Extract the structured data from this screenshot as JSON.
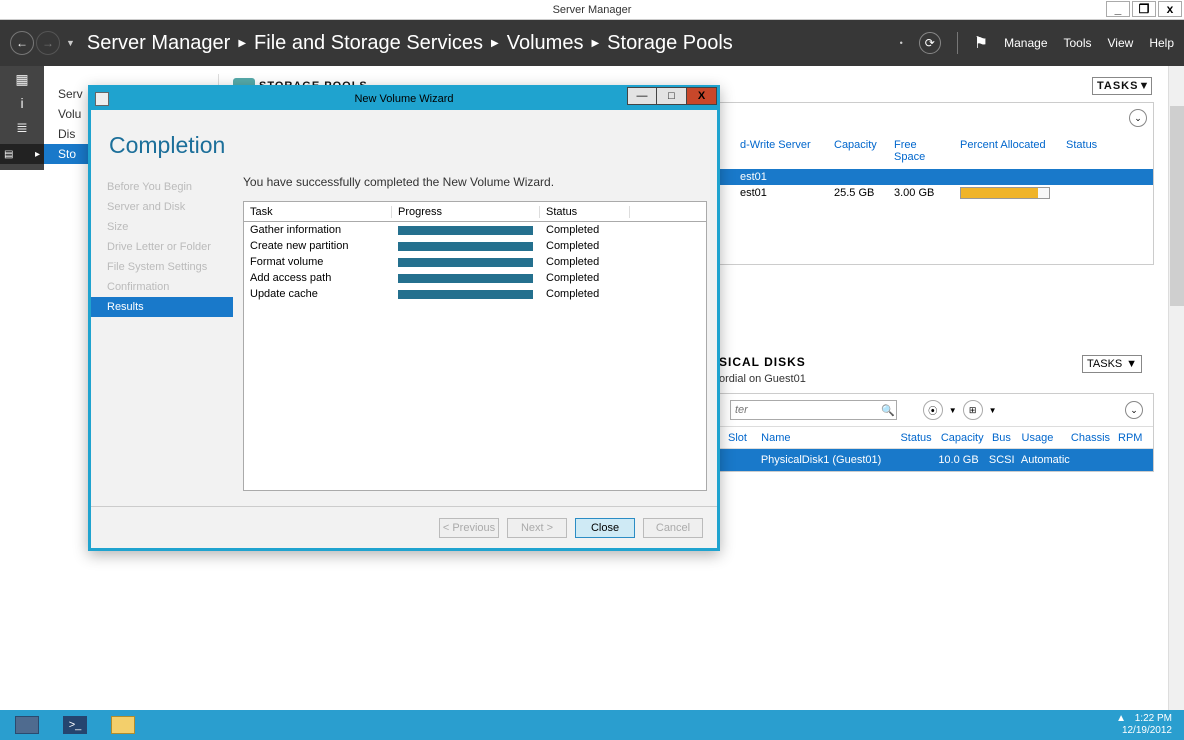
{
  "window": {
    "title": "Server Manager",
    "min": "_",
    "max": "❐",
    "close": "x"
  },
  "nav": {
    "app": "Server Manager",
    "crumbs": [
      "File and Storage Services",
      "Volumes",
      "Storage Pools"
    ],
    "menu": {
      "manage": "Manage",
      "tools": "Tools",
      "view": "View",
      "help": "Help"
    }
  },
  "sidelist": {
    "items": [
      "Serv",
      "Volu",
      "Dis",
      "Sto"
    ],
    "selectedIndex": 3
  },
  "storagePools": {
    "header": "STORAGE POOLS",
    "tasks": "TASKS",
    "columns": [
      "d-Write Server",
      "Capacity",
      "Free Space",
      "Percent Allocated",
      "Status"
    ],
    "rows": [
      {
        "server": "est01",
        "capacity": "",
        "free": "",
        "alloc": null,
        "selected": true
      },
      {
        "server": "est01",
        "capacity": "25.5 GB",
        "free": "3.00 GB",
        "alloc": 0.88,
        "selected": false
      }
    ]
  },
  "physicalDisks": {
    "header": "SICAL DISKS",
    "sub": "ordial on Guest01",
    "tasks": "TASKS",
    "filter_placeholder": "ter",
    "columns": [
      "Slot",
      "Name",
      "Status",
      "Capacity",
      "Bus",
      "Usage",
      "Chassis",
      "RPM"
    ],
    "row": {
      "slot": "",
      "name": "PhysicalDisk1 (Guest01)",
      "status": "",
      "capacity": "10.0 GB",
      "bus": "SCSI",
      "usage": "Automatic",
      "chassis": "",
      "rpm": ""
    }
  },
  "dialog": {
    "title": "New Volume Wizard",
    "heading": "Completion",
    "steps": [
      "Before You Begin",
      "Server and Disk",
      "Size",
      "Drive Letter or Folder",
      "File System Settings",
      "Confirmation",
      "Results"
    ],
    "activeStep": 6,
    "message": "You have successfully completed the New Volume Wizard.",
    "table": {
      "headers": [
        "Task",
        "Progress",
        "Status"
      ],
      "rows": [
        {
          "task": "Gather information",
          "status": "Completed"
        },
        {
          "task": "Create new partition",
          "status": "Completed"
        },
        {
          "task": "Format volume",
          "status": "Completed"
        },
        {
          "task": "Add access path",
          "status": "Completed"
        },
        {
          "task": "Update cache",
          "status": "Completed"
        }
      ]
    },
    "buttons": {
      "previous": "< Previous",
      "next": "Next >",
      "close": "Close",
      "cancel": "Cancel"
    }
  },
  "taskbar": {
    "time": "1:22 PM",
    "date": "12/19/2012"
  }
}
